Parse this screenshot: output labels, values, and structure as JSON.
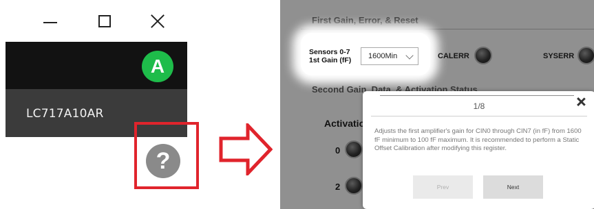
{
  "window": {
    "avatar_letter": "A",
    "device_name": "LC717A10AR"
  },
  "help": {
    "symbol": "?",
    "icon": "question-circle-icon",
    "highlight_color": "#e0242c"
  },
  "panel": {
    "section1_title": "First Gain, Error, & Reset",
    "gain_label_line1": "Sensors 0-7",
    "gain_label_line2": "1st Gain (fF)",
    "gain_value": "1600Min",
    "calerr_label": "CALERR",
    "syserr_label": "SYSERR",
    "section2_title": "Second Gain, Data, & Activation Status",
    "activation_label": "Activatio",
    "row_labels": [
      "0",
      "2"
    ]
  },
  "popup": {
    "page_indicator": "1/8",
    "body": "Adjusts the first amplifier's gain for CIN0 through CIN7 (in fF) from 1600 fF minimum to 100 fF maximum. It is recommended to perform a Static Offset Calibration after modifying this register.",
    "prev_label": "Prev",
    "next_label": "Next"
  },
  "colors": {
    "avatar": "#1ebc4a",
    "title_bar": "#121212",
    "device_bar": "#3b3b3b",
    "panel_bg": "#909090"
  }
}
